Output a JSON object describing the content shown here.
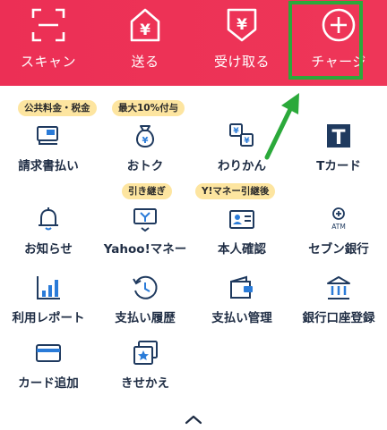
{
  "header": {
    "buttons": [
      {
        "label": "スキャン",
        "icon": "scan-icon"
      },
      {
        "label": "送る",
        "icon": "send-yen-icon"
      },
      {
        "label": "受け取る",
        "icon": "receive-yen-icon"
      },
      {
        "label": "チャージ",
        "icon": "plus-circle-icon"
      }
    ]
  },
  "badges": {
    "bills": "公共料金・税金",
    "deals": "最大10%付与",
    "yahoo": "引き継ぎ",
    "identity": "Y!マネー引継後"
  },
  "menu": {
    "row1": [
      "請求書払い",
      "おトク",
      "わりかん",
      "Tカード"
    ],
    "row2": [
      "お知らせ",
      "Yahoo!マネー",
      "本人確認",
      "セブン銀行"
    ],
    "row3": [
      "利用レポート",
      "支払い履歴",
      "支払い管理",
      "銀行口座登録"
    ],
    "row4": [
      "カード追加",
      "きせかえ"
    ]
  },
  "icon_texts": {
    "yen": "¥",
    "t_logo": "T",
    "atm": "ATM"
  },
  "colors": {
    "header_red": "#ec2f55",
    "highlight_green": "#2ba93a",
    "icon_navy": "#1f3a5f",
    "icon_blue": "#2a7bd8",
    "badge_yellow": "#fde5a0"
  }
}
